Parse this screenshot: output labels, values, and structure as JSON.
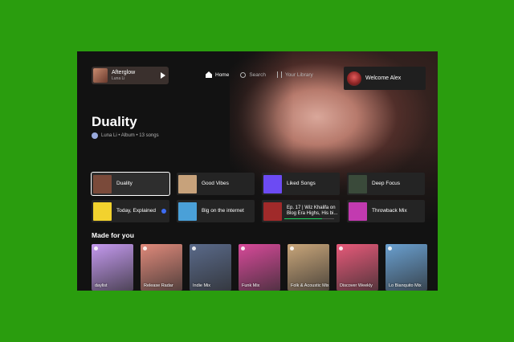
{
  "now_playing": {
    "title": "Afterglow",
    "artist": "Luna Li"
  },
  "nav": {
    "home": "Home",
    "search": "Search",
    "library": "Your Library"
  },
  "welcome": "Welcome Alex",
  "album": {
    "title": "Duality",
    "meta": "Luna Li • Album • 13 songs"
  },
  "shortcuts": [
    {
      "label": "Duality",
      "color": "#7a4a3a"
    },
    {
      "label": "Good Vibes",
      "color": "#c7a27b"
    },
    {
      "label": "Liked Songs",
      "color": "#6c4bf3"
    },
    {
      "label": "Deep Focus",
      "color": "#3a4a3a"
    },
    {
      "label": "Today, Explained",
      "color": "#f2d22e"
    },
    {
      "label": "Big on the internet",
      "color": "#4aa0d8"
    },
    {
      "label": "Ep. 17 | Wiz Khalifa on Blog Era Highs, His bi...",
      "color": "#a02a2a"
    },
    {
      "label": "Throwback Mix",
      "color": "#c23ab0"
    }
  ],
  "shortcut_progress": 0.75,
  "section_title": "Made for you",
  "cards": [
    {
      "label": "daylist",
      "color": "#c59af0"
    },
    {
      "label": "Release Radar",
      "color": "#e08a7b"
    },
    {
      "label": "Indie Mix",
      "color": "#5a6a8a"
    },
    {
      "label": "Funk Mix",
      "color": "#d84a9a"
    },
    {
      "label": "Folk & Acoustic Mix",
      "color": "#c9a67a"
    },
    {
      "label": "Discover Weekly",
      "color": "#e85a7a"
    },
    {
      "label": "Lo Bianquito Mix",
      "color": "#6aa0d0"
    }
  ]
}
